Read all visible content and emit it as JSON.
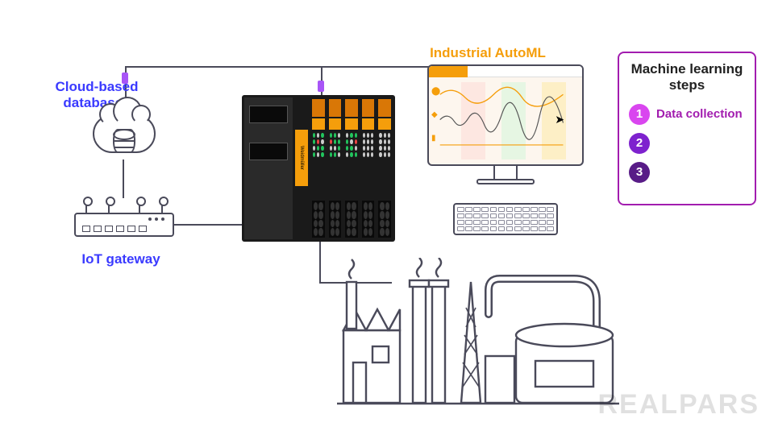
{
  "labels": {
    "cloud": "Cloud-based databases",
    "iot": "IoT gateway",
    "automl": "Industrial AutoML"
  },
  "mlbox": {
    "title": "Machine learning steps",
    "steps": [
      {
        "n": "1",
        "label": "Data collection"
      },
      {
        "n": "2",
        "label": ""
      },
      {
        "n": "3",
        "label": ""
      }
    ]
  },
  "plc": {
    "brand": "Weidmüller"
  },
  "watermark": "REALPARS",
  "colors": {
    "link_blue": "#3a3aff",
    "orange": "#f59e0b",
    "purple": "#a21caf"
  }
}
